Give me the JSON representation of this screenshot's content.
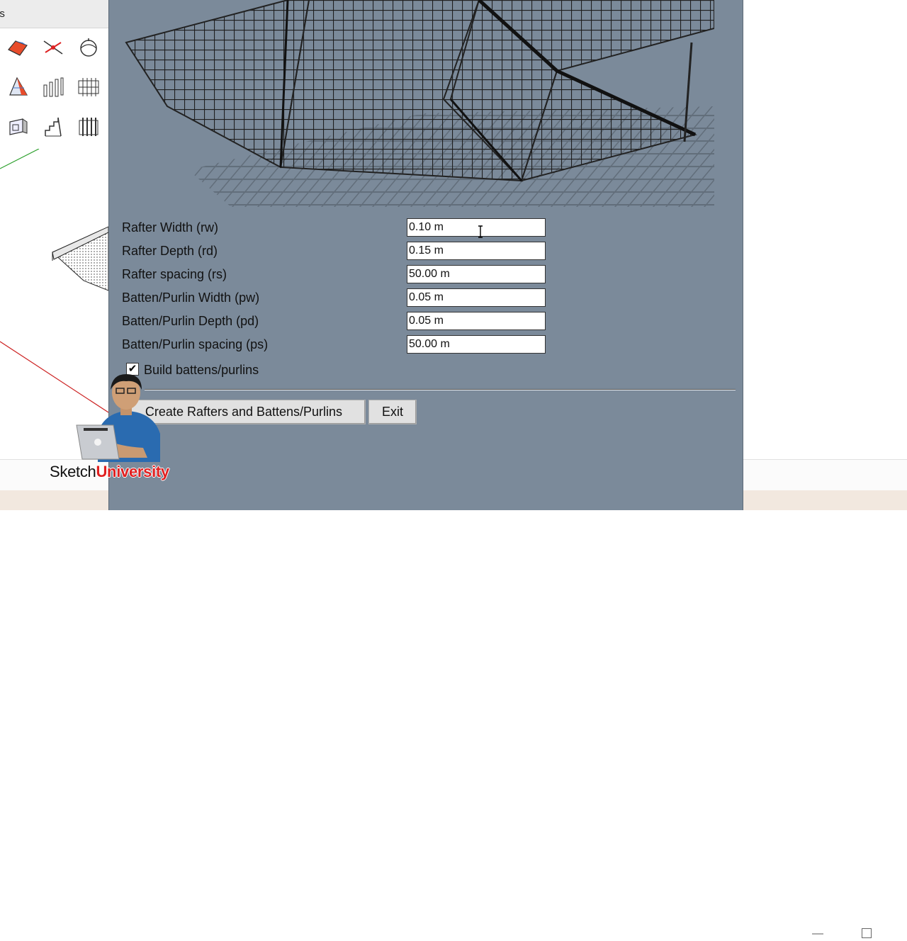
{
  "palette": {
    "title": "ls",
    "tools": [
      {
        "name": "roof-tool-icon"
      },
      {
        "name": "rafter-line-tool-icon"
      },
      {
        "name": "dome-tool-icon"
      },
      {
        "name": "sail-roof-tool-icon"
      },
      {
        "name": "columns-tool-icon"
      },
      {
        "name": "truss-tool-icon"
      },
      {
        "name": "wall-panel-tool-icon"
      },
      {
        "name": "stair-tool-icon"
      },
      {
        "name": "fence-tool-icon"
      }
    ]
  },
  "dialog": {
    "fields": [
      {
        "label": "Rafter Width (rw)",
        "value": "0.10 m"
      },
      {
        "label": "Rafter Depth (rd)",
        "value": "0.15 m"
      },
      {
        "label": "Rafter spacing (rs)",
        "value": "50.00 m"
      },
      {
        "label": "Batten/Purlin Width (pw)",
        "value": "0.05 m"
      },
      {
        "label": "Batten/Purlin Depth (pd)",
        "value": "0.05 m"
      },
      {
        "label": "Batten/Purlin spacing (ps)",
        "value": "50.00 m"
      }
    ],
    "checkbox": {
      "label": "Build battens/purlins",
      "checked": true,
      "mark": "✔"
    },
    "buttons": {
      "create": "Create Rafters and Battens/Purlins",
      "exit": "Exit"
    }
  },
  "window_controls": {
    "minimize": "—"
  },
  "branding": {
    "part1": "Sketch",
    "part2": "University"
  },
  "colors": {
    "dialog_bg": "#7b8a9a",
    "brand_red": "#e02020",
    "axis_green": "#2ca02c",
    "axis_red": "#cc2222"
  }
}
